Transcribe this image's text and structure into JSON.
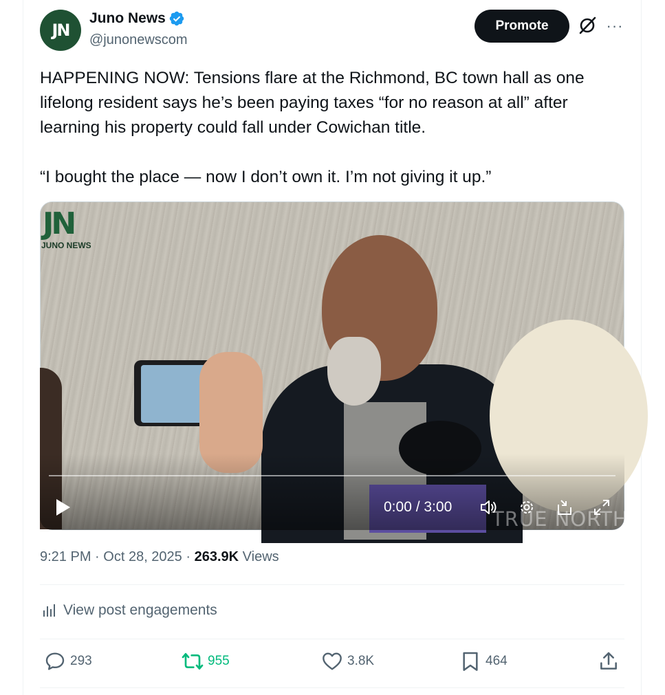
{
  "author": {
    "display_name": "Juno News",
    "handle": "@junonewscom",
    "avatar_text": "JN",
    "avatar_color": "#1f5133",
    "verified": true,
    "verified_color": "#1d9bf0"
  },
  "header": {
    "promote_label": "Promote",
    "grok_icon": "grok-icon",
    "more_icon": "more-icon",
    "more_label": "···"
  },
  "tweet": {
    "paragraph_1": "HAPPENING NOW: Tensions flare at the Richmond, BC town hall as one lifelong resident says he’s been paying taxes “for no reason at all” after learning his property could fall under Cowichan title.",
    "paragraph_2": "“I bought the place — now I don’t own it. I’m not giving it up.”"
  },
  "video": {
    "watermark_mark": "JN",
    "watermark_label": "JUNO NEWS",
    "overlay_brand": "TRUE NORTH",
    "time_display": "0:00 / 3:00",
    "progress_fraction": 0,
    "controls": [
      "play-icon",
      "volume-icon",
      "settings-icon",
      "pip-icon",
      "fullscreen-icon"
    ]
  },
  "meta": {
    "time": "9:21 PM",
    "date": "Oct 28, 2025",
    "separator": "·",
    "views_count": "263.9K",
    "views_label": "Views"
  },
  "engagements": {
    "label": "View post engagements",
    "icon": "analytics-icon"
  },
  "actions": {
    "replies": "293",
    "reposts": "955",
    "likes": "3.8K",
    "bookmarks": "464",
    "repost_color": "#00ba7c"
  }
}
